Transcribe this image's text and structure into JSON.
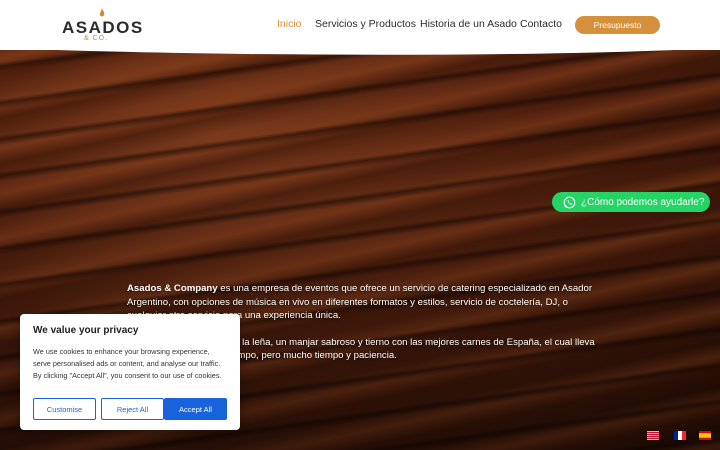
{
  "brand": {
    "name": "ASADOS",
    "sub": "& CO."
  },
  "nav": {
    "items": [
      {
        "label": "Inicio",
        "active": true
      },
      {
        "label": "Servicios y Productos",
        "active": false
      },
      {
        "label": "Historia de un Asado",
        "active": false
      },
      {
        "label": "Contacto",
        "active": false
      }
    ],
    "cta_label": "Presupuesto"
  },
  "whatsapp": {
    "label": "¿Cómo podemos ayudarle?",
    "icon": "whatsapp-icon"
  },
  "content": {
    "p1_strong": "Asados & Company",
    "p1_rest": " es una empresa de eventos que ofrece un servicio de catering especializado en Asador Argentino, con opciones de música en vivo en diferentes formatos y estilos, servicio de coctelería, DJ, o cualquier otro servicio para una experiencia única.",
    "p2": "Especialistas en costillar a la leña, un manjar sabroso y tierno con las mejores carnes de España, el cual lleva fuego, carbón y mucho tiempo, pero mucho tiempo y paciencia."
  },
  "cookie": {
    "title": "We value your privacy",
    "text": "We use cookies to enhance your browsing experience, serve personalised ads or content, and analyse our traffic. By clicking \"Accept All\", you consent to our use of cookies.",
    "customise": "Customise",
    "reject": "Reject All",
    "accept": "Accept All"
  },
  "languages": [
    "Català",
    "Français",
    "Español"
  ],
  "colors": {
    "accent": "#d4903a",
    "whatsapp": "#25d366",
    "cookie_blue": "#1863dc"
  }
}
